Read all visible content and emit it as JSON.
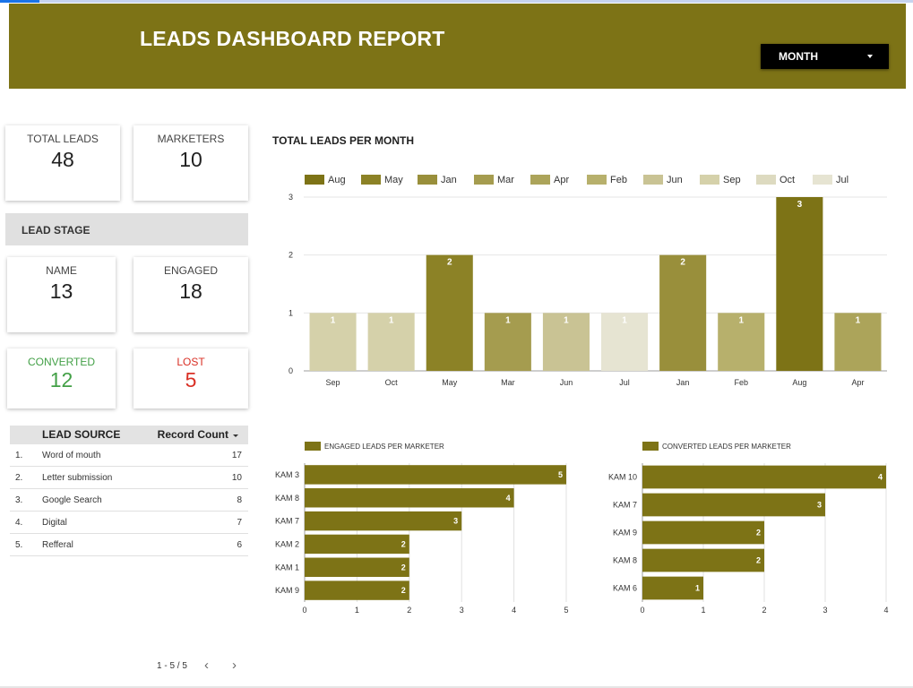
{
  "header": {
    "title": "LEADS DASHBOARD REPORT",
    "dropdown_label": "MONTH"
  },
  "scorecards": {
    "total_leads": {
      "label": "TOTAL LEADS",
      "value": "48"
    },
    "marketers": {
      "label": "MARKETERS",
      "value": "10"
    },
    "name": {
      "label": "NAME",
      "value": "13"
    },
    "engaged": {
      "label": "ENGAGED",
      "value": "18"
    },
    "converted": {
      "label": "CONVERTED",
      "value": "12"
    },
    "lost": {
      "label": "LOST",
      "value": "5"
    }
  },
  "lead_stage_title": "LEAD STAGE",
  "lead_source": {
    "col_name": "LEAD SOURCE",
    "col_count": "Record Count",
    "rows": [
      {
        "n": "1.",
        "name": "Word of mouth",
        "count": "17"
      },
      {
        "n": "2.",
        "name": "Letter submission",
        "count": "10"
      },
      {
        "n": "3.",
        "name": "Google Search",
        "count": "8"
      },
      {
        "n": "4.",
        "name": "Digital",
        "count": "7"
      },
      {
        "n": "5.",
        "name": "Refferal",
        "count": "6"
      }
    ],
    "pagination": "1 - 5 / 5",
    "prev": "‹",
    "next": "›"
  },
  "colors": {
    "olive": "#7d7316",
    "converted": "#43a047",
    "lost": "#d93025"
  },
  "chart_data": [
    {
      "type": "bar",
      "title": "TOTAL LEADS PER MONTH",
      "categories": [
        "Sep",
        "Oct",
        "May",
        "Mar",
        "Jun",
        "Jul",
        "Jan",
        "Feb",
        "Aug",
        "Apr"
      ],
      "values": [
        1,
        1,
        2,
        1,
        1,
        1,
        2,
        1,
        3,
        1
      ],
      "colors": [
        "#d5d1aa",
        "#d5d1aa",
        "#8c8226",
        "#a59c4f",
        "#c9c394",
        "#e6e4d2",
        "#998f3b",
        "#b7b06c",
        "#7d7316",
        "#aca45a"
      ],
      "legend": {
        "labels": [
          "Aug",
          "May",
          "Jan",
          "Mar",
          "Apr",
          "Feb",
          "Jun",
          "Sep",
          "Oct",
          "Jul"
        ],
        "colors": [
          "#7d7316",
          "#8c8226",
          "#998f3b",
          "#a59c4f",
          "#aca45a",
          "#b7b06c",
          "#c9c394",
          "#d5d1aa",
          "#dddac0",
          "#e6e4d2"
        ]
      },
      "ylim": [
        0,
        3
      ],
      "yticks": [
        "0",
        "1",
        "2",
        "3"
      ],
      "grid": true,
      "legend_position": "top"
    },
    {
      "type": "bar",
      "orientation": "horizontal",
      "series_name": "ENGAGED LEADS PER MARKETER",
      "categories": [
        "KAM 3",
        "KAM 8",
        "KAM 7",
        "KAM 2",
        "KAM 1",
        "KAM 9"
      ],
      "values": [
        5,
        4,
        3,
        2,
        2,
        2
      ],
      "xlim": [
        0,
        5
      ],
      "xticks": [
        "0",
        "1",
        "2",
        "3",
        "4",
        "5"
      ],
      "color": "#7d7316",
      "grid": true,
      "legend_position": "top"
    },
    {
      "type": "bar",
      "orientation": "horizontal",
      "series_name": "CONVERTED LEADS PER MARKETER",
      "categories": [
        "KAM 10",
        "KAM 7",
        "KAM 9",
        "KAM 8",
        "KAM 6"
      ],
      "values": [
        4,
        3,
        2,
        2,
        1
      ],
      "xlim": [
        0,
        4
      ],
      "xticks": [
        "0",
        "1",
        "2",
        "3",
        "4"
      ],
      "color": "#7d7316",
      "grid": true,
      "legend_position": "top"
    }
  ]
}
